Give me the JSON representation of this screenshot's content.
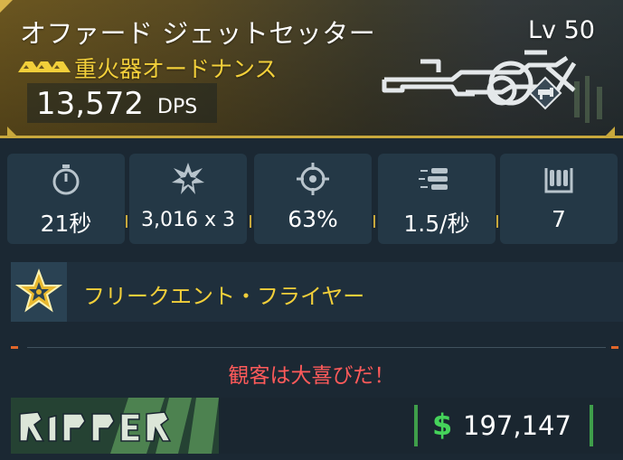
{
  "weapon": {
    "name": "オファード ジェットセッター",
    "level": "Lv 50",
    "type": "重火器オードナンス",
    "dps_value": "13,572",
    "dps_label": "DPS"
  },
  "stats": [
    {
      "icon": "stopwatch-icon",
      "value": "21秒"
    },
    {
      "icon": "explosion-icon",
      "value": "3,016 x 3"
    },
    {
      "icon": "crosshair-icon",
      "value": "63%"
    },
    {
      "icon": "bullets-icon",
      "value": "1.5/秒"
    },
    {
      "icon": "magazine-icon",
      "value": "7"
    }
  ],
  "perk": {
    "icon": "star-badge-icon",
    "name": "フリークエント・フライヤー"
  },
  "flavor_text": "観客は大喜びだ！",
  "brand": {
    "logo_text": "RIPPER"
  },
  "price": {
    "symbol": "$",
    "value": "197,147"
  },
  "colors": {
    "rarity_gold": "#c8a83c",
    "perk_yellow": "#f2cf3a",
    "flavor_red": "#ff5a5a",
    "money_green": "#45d35a"
  }
}
